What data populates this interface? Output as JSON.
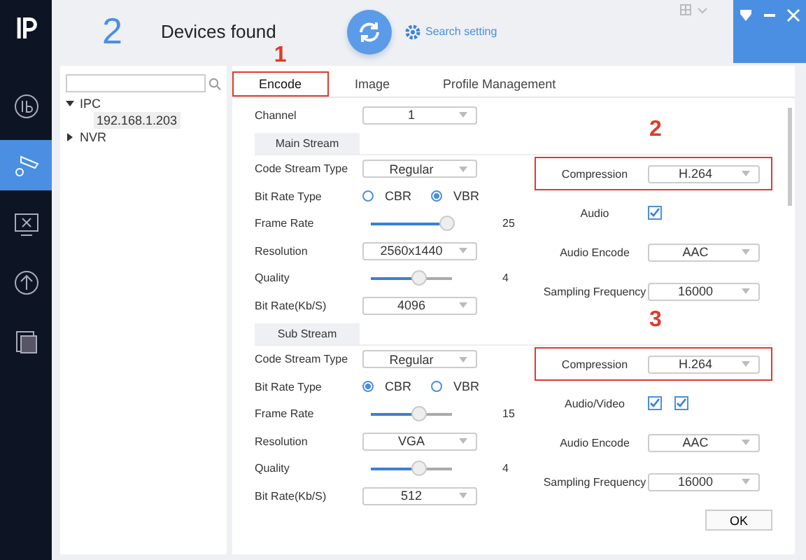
{
  "header": {
    "count": "2",
    "title": "Devices found",
    "search_setting": "Search setting"
  },
  "nav": [
    {
      "selected": false
    },
    {
      "selected": true
    },
    {
      "selected": false
    },
    {
      "selected": false
    },
    {
      "selected": false
    }
  ],
  "tree": {
    "items": [
      {
        "label": "IPC",
        "expanded": true,
        "children": [
          {
            "label": "192.168.1.203",
            "selected": true
          }
        ]
      },
      {
        "label": "NVR",
        "expanded": false
      }
    ]
  },
  "tabs": [
    {
      "label": "Encode",
      "selected": true,
      "annotation": "1"
    },
    {
      "label": "Image",
      "selected": false
    },
    {
      "label": "Profile Management",
      "selected": false
    }
  ],
  "channel": {
    "label": "Channel",
    "value": "1"
  },
  "streams": [
    {
      "title": "Main Stream",
      "annotation": "2",
      "left": [
        {
          "kind": "select",
          "label": "Code Stream Type",
          "value": "Regular"
        },
        {
          "kind": "radio",
          "label": "Bit Rate Type",
          "options": [
            {
              "label": "CBR",
              "selected": false
            },
            {
              "label": "VBR",
              "selected": true
            }
          ]
        },
        {
          "kind": "slider",
          "label": "Frame Rate",
          "level": 0.95,
          "reading": "25"
        },
        {
          "kind": "select",
          "label": "Resolution",
          "value": "2560x1440"
        },
        {
          "kind": "slider",
          "label": "Quality",
          "level": 0.6,
          "reading": "4"
        },
        {
          "kind": "select",
          "label": "Bit Rate(Kb/S)",
          "value": "4096"
        }
      ],
      "right": [
        {
          "kind": "select",
          "label": "Compression",
          "value": "H.264",
          "highlighted": true
        },
        {
          "kind": "check",
          "label": "Audio",
          "checks": [
            {
              "checked": true
            }
          ]
        },
        {
          "kind": "select",
          "label": "Audio Encode",
          "value": "AAC",
          "highlighted": false
        },
        {
          "kind": "select",
          "label": "Sampling Frequency",
          "value": "16000",
          "highlighted": false
        }
      ]
    },
    {
      "title": "Sub Stream",
      "annotation": "3",
      "left": [
        {
          "kind": "select",
          "label": "Code Stream Type",
          "value": "Regular"
        },
        {
          "kind": "radio",
          "label": "Bit Rate Type",
          "options": [
            {
              "label": "CBR",
              "selected": true
            },
            {
              "label": "VBR",
              "selected": false
            }
          ]
        },
        {
          "kind": "slider",
          "label": "Frame Rate",
          "level": 0.6,
          "reading": "15"
        },
        {
          "kind": "select",
          "label": "Resolution",
          "value": "VGA"
        },
        {
          "kind": "slider",
          "label": "Quality",
          "level": 0.6,
          "reading": "4"
        },
        {
          "kind": "select",
          "label": "Bit Rate(Kb/S)",
          "value": "512"
        }
      ],
      "right": [
        {
          "kind": "select",
          "label": "Compression",
          "value": "H.264",
          "highlighted": true
        },
        {
          "kind": "check",
          "label": "Audio/Video",
          "checks": [
            {
              "checked": true
            },
            {
              "checked": true
            }
          ]
        },
        {
          "kind": "select",
          "label": "Audio Encode",
          "value": "AAC",
          "highlighted": false
        },
        {
          "kind": "select",
          "label": "Sampling Frequency",
          "value": "16000",
          "highlighted": false
        }
      ]
    }
  ],
  "ok": "OK"
}
